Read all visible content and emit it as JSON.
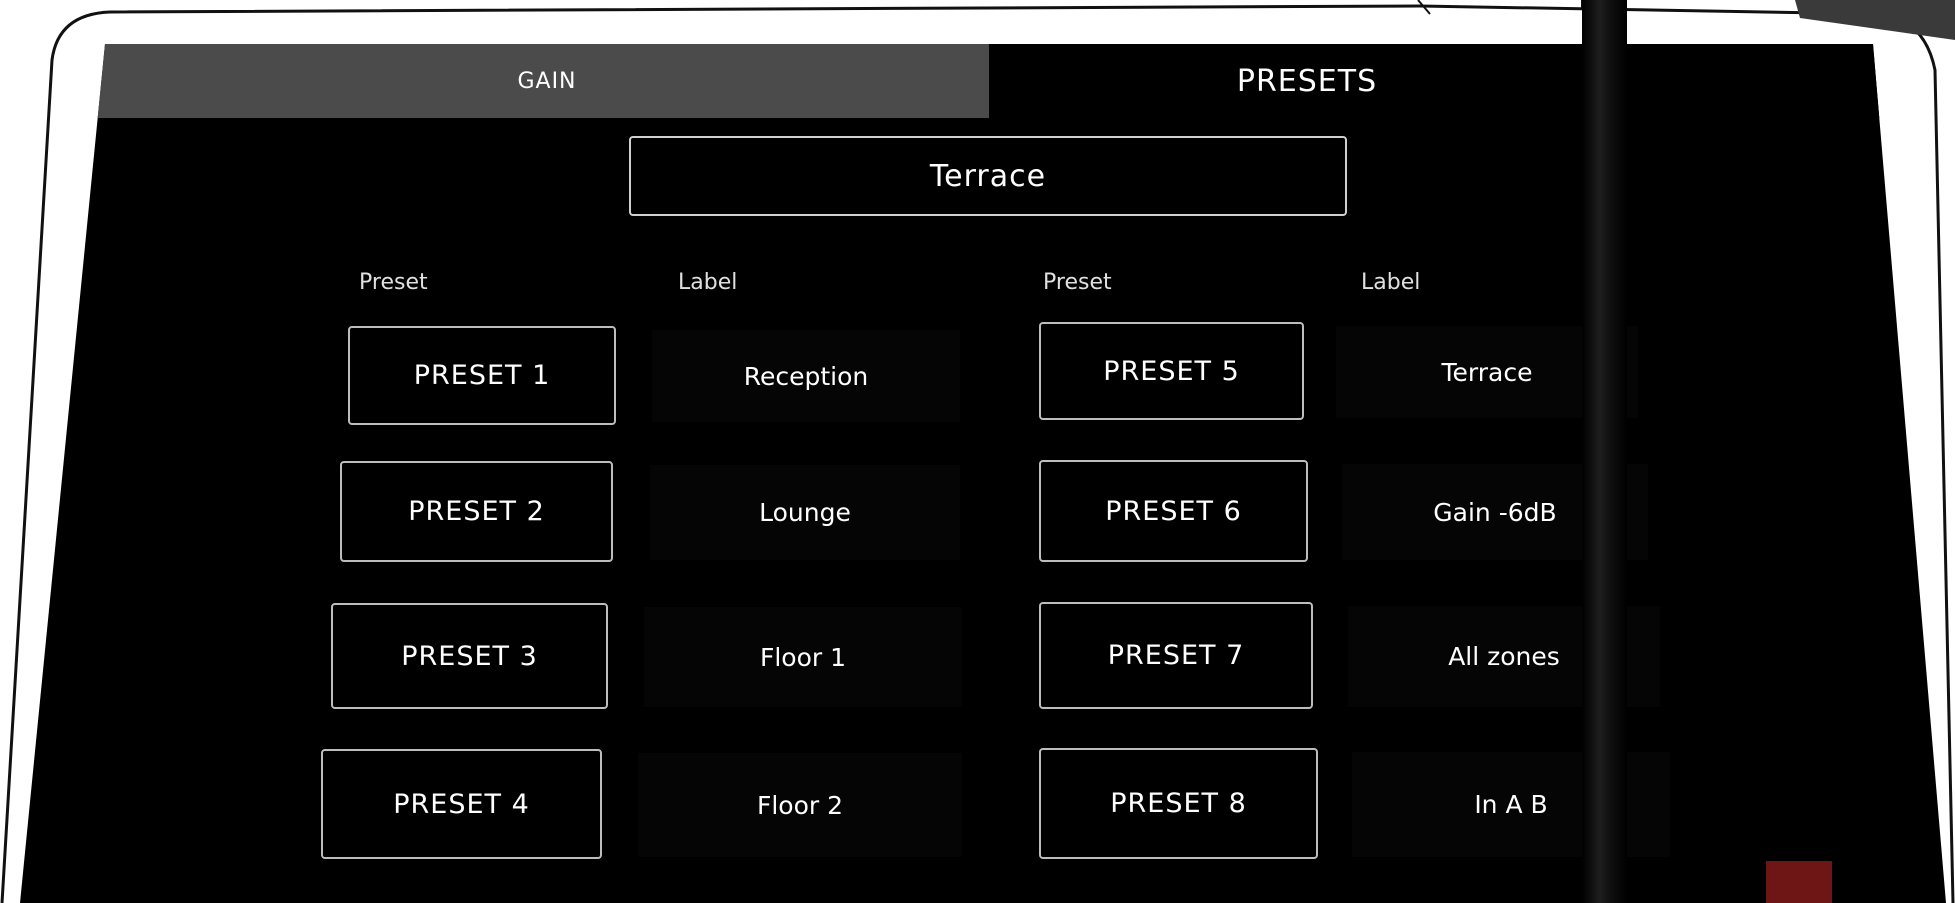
{
  "tabs": {
    "gain": "GAIN",
    "presets": "PRESETS"
  },
  "zone": "Terrace",
  "headers": {
    "left_preset": "Preset",
    "left_label": "Label",
    "right_preset": "Preset",
    "right_label": "Label"
  },
  "presets": [
    {
      "button": "PRESET 1",
      "label": "Reception"
    },
    {
      "button": "PRESET 2",
      "label": "Lounge"
    },
    {
      "button": "PRESET 3",
      "label": "Floor 1"
    },
    {
      "button": "PRESET 4",
      "label": "Floor 2"
    },
    {
      "button": "PRESET 5",
      "label": "Terrace"
    },
    {
      "button": "PRESET 6",
      "label": "Gain -6dB"
    },
    {
      "button": "PRESET 7",
      "label": "All zones"
    },
    {
      "button": "PRESET 8",
      "label": "In A B"
    }
  ],
  "colors": {
    "screen_bg": "#000000",
    "tab_inactive": "#4b4b4b",
    "button_border": "#bdbdbd",
    "indicator": "#6e1515"
  }
}
